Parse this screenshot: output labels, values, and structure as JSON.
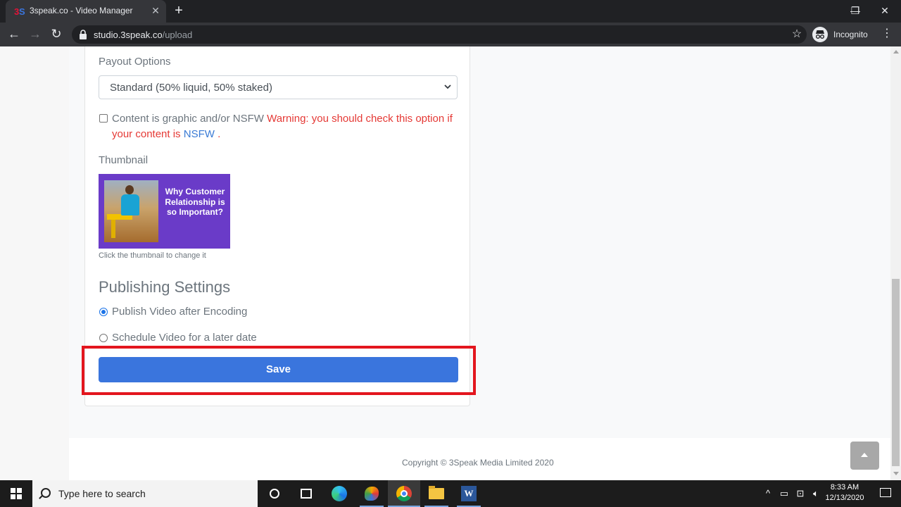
{
  "browser": {
    "tab_title": "3speak.co - Video Manager",
    "url_host": "studio.3speak.co",
    "url_path": "/upload",
    "profile_label": "Incognito"
  },
  "form": {
    "payout_label": "Payout Options",
    "payout_selected": "Standard (50% liquid, 50% staked)",
    "nsfw_label": "Content is graphic and/or NSFW",
    "nsfw_warning": "Warning: you should check this option if your content is",
    "nsfw_link": "NSFW",
    "nsfw_period": ".",
    "thumbnail_label": "Thumbnail",
    "thumbnail_caption": "Why Customer Relationship is so Important?",
    "thumbnail_hint": "Click the thumbnail to change it",
    "publishing_title": "Publishing Settings",
    "radio_publish": "Publish Video after Encoding",
    "radio_schedule": "Schedule Video for a later date",
    "publish_selected": "publish",
    "save_label": "Save"
  },
  "footer": {
    "copyright": "Copyright © 3Speak Media Limited 2020"
  },
  "taskbar": {
    "search_placeholder": "Type here to search",
    "time": "8:33 AM",
    "date": "12/13/2020"
  },
  "colors": {
    "accent": "#3a75dd",
    "warning": "#e53935",
    "highlight": "#e3161e"
  }
}
